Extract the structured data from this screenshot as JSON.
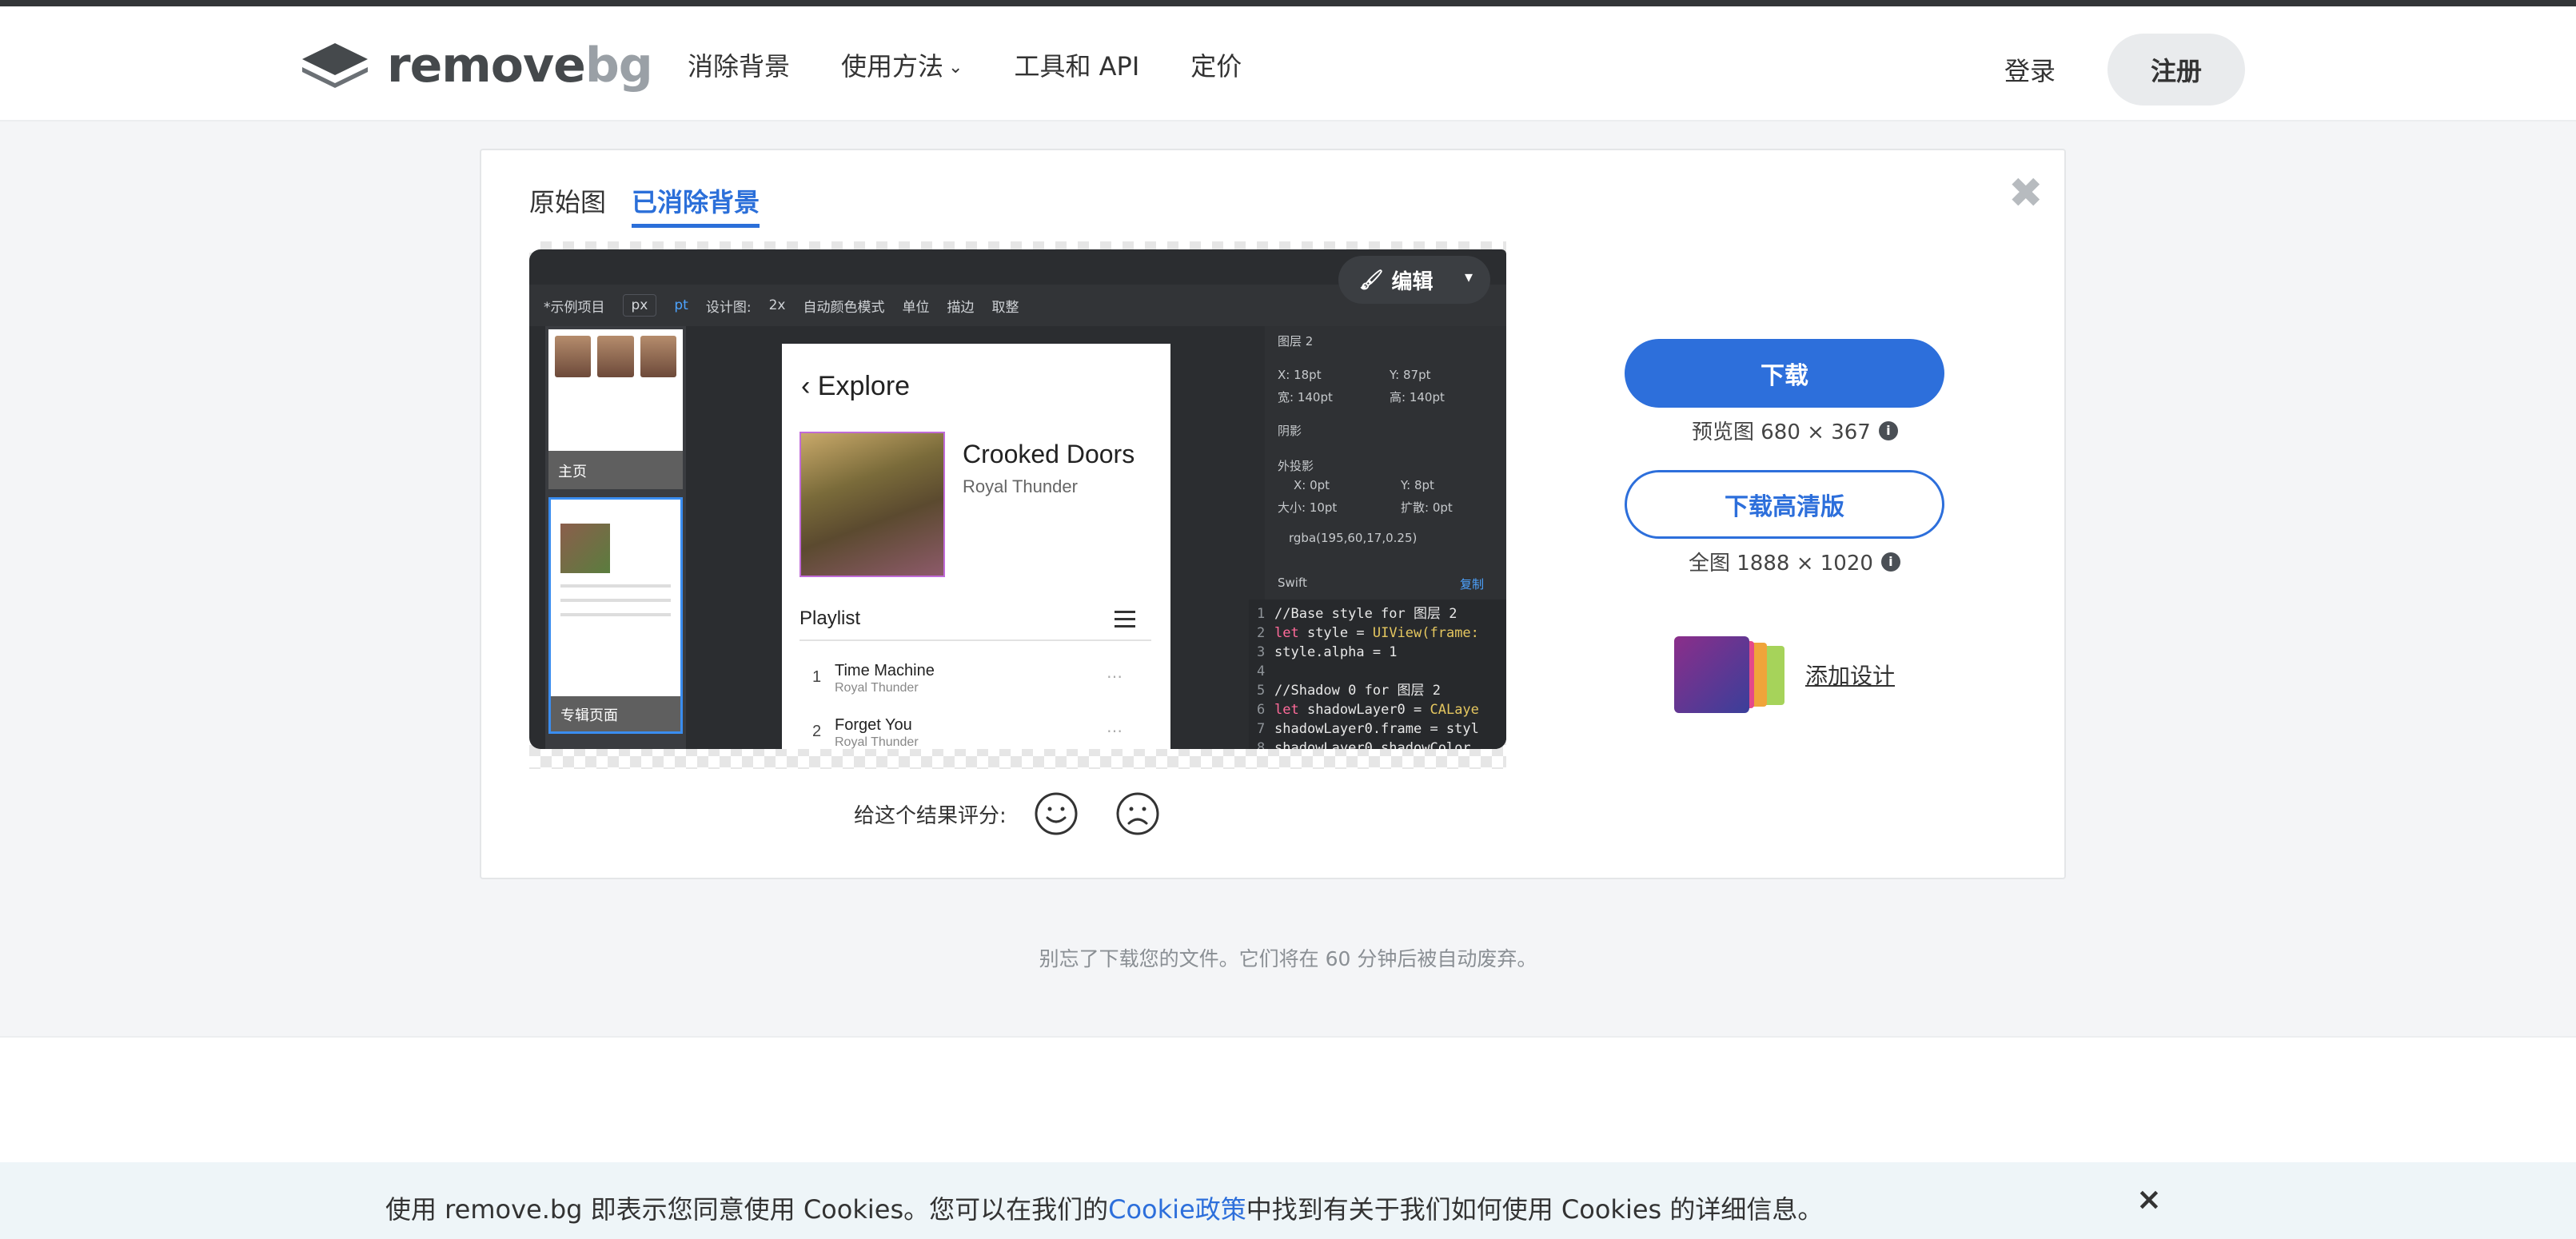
{
  "brand": {
    "name_part1": "remove",
    "name_part2": "bg"
  },
  "nav": {
    "items": [
      "消除背景",
      "使用方法",
      "工具和 API",
      "定价"
    ],
    "login": "登录",
    "signup": "注册"
  },
  "tabs": {
    "original": "原始图",
    "removed": "已消除背景",
    "active": "removed"
  },
  "preview_app": {
    "toolbar": [
      "*示例项目",
      "px",
      "pt",
      "设计图:",
      "2x",
      "自动颜色模式",
      "单位",
      "描边",
      "取整"
    ],
    "thumb_labels": [
      "主页",
      "专辑页面"
    ],
    "explore_title": "Explore",
    "album_title": "Crooked Doors",
    "album_artist": "Royal Thunder",
    "playlist_label": "Playlist",
    "tracks": [
      {
        "n": "1",
        "title": "Time Machine",
        "artist": "Royal Thunder"
      },
      {
        "n": "2",
        "title": "Forget You",
        "artist": "Royal Thunder"
      }
    ],
    "inspector": {
      "layer": "图层 2",
      "x": "X: 18pt",
      "y": "Y: 87pt",
      "w": "宽: 140pt",
      "h": "高: 140pt",
      "shadow": "阴影",
      "outer": "外投影",
      "sx": "X: 0pt",
      "sy": "Y: 8pt",
      "size": "大小: 10pt",
      "spread": "扩散: 0pt",
      "color": "rgba(195,60,17,0.25)",
      "lang": "Swift",
      "copy": "复制"
    },
    "code_lines": [
      {
        "ln": "1",
        "text": "//Base style for 图层 2"
      },
      {
        "ln": "2",
        "kw": "let",
        "text": " style = ",
        "ty": "UIView(frame:"
      },
      {
        "ln": "3",
        "text": "style.alpha = 1"
      },
      {
        "ln": "4",
        "text": ""
      },
      {
        "ln": "5",
        "text": "//Shadow 0 for 图层 2"
      },
      {
        "ln": "6",
        "kw": "let",
        "text": " shadowLayer0 = ",
        "ty": "CALaye"
      },
      {
        "ln": "7",
        "text": "shadowLayer0.frame = styl"
      },
      {
        "ln": "8",
        "text": "shadowLayer0.shadowColor"
      }
    ]
  },
  "edit_button": "编辑",
  "rating": {
    "label": "给这个结果评分:"
  },
  "download": {
    "button": "下载",
    "preview_meta": "预览图 680 × 367",
    "hd_button": "下载高清版",
    "full_meta": "全图 1888 × 1020"
  },
  "add_design": "添加设计",
  "footer_note": "别忘了下载您的文件。它们将在 60 分钟后被自动废弃。",
  "cookie": {
    "text_before": "使用 remove.bg 即表示您同意使用 Cookies。您可以在我们的",
    "link": "Cookie政策",
    "text_after": "中找到有关于我们如何使用 Cookies 的详细信息。",
    "close": "×"
  },
  "colors": {
    "accent": "#2d6fdb",
    "text": "#333333",
    "page_bg": "#f4f5f7"
  }
}
